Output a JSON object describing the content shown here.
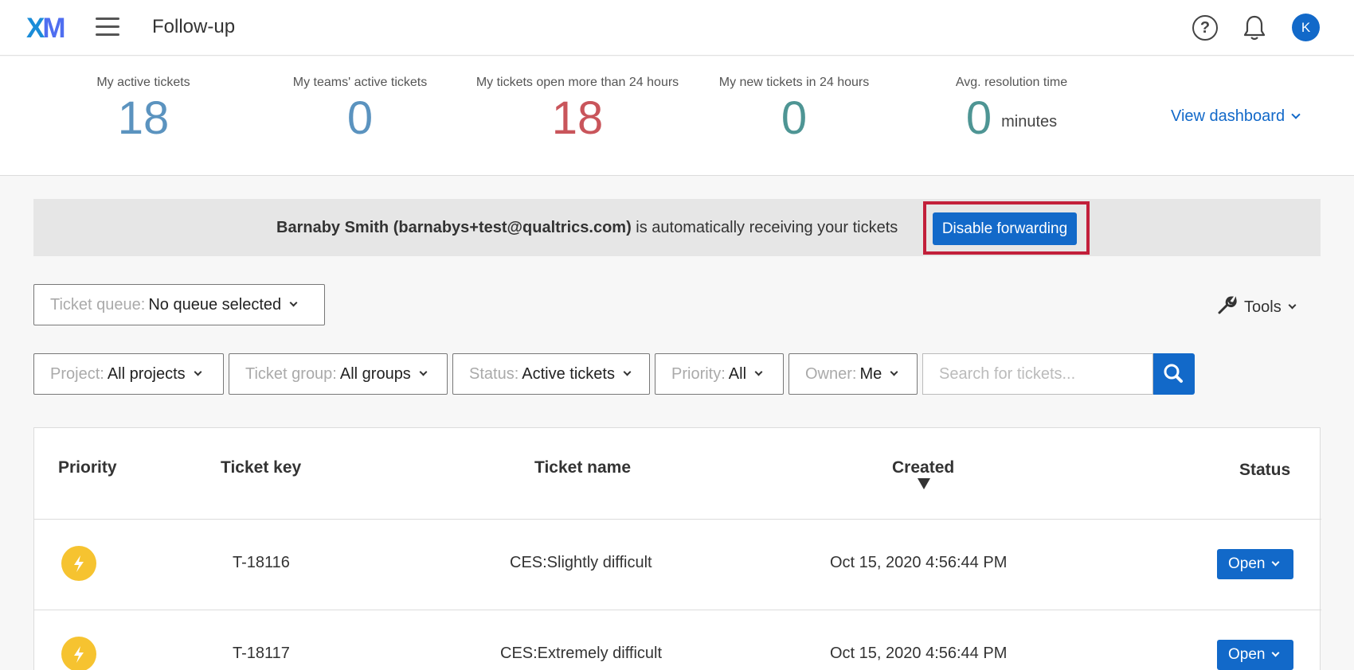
{
  "header": {
    "logo": {
      "x": "X",
      "m": "M"
    },
    "title": "Follow-up",
    "help_symbol": "?",
    "avatar_initial": "K",
    "icons": [
      "menu-icon",
      "help-icon",
      "bell-icon"
    ]
  },
  "stats": [
    {
      "label": "My active tickets",
      "value": "18",
      "color": "#5b93bf"
    },
    {
      "label": "My teams' active tickets",
      "value": "0",
      "color": "#5b93bf"
    },
    {
      "label": "My tickets open more than 24 hours",
      "value": "18",
      "color": "#c9555b"
    },
    {
      "label": "My new tickets in 24 hours",
      "value": "0",
      "color": "#4e9594"
    },
    {
      "label": "Avg. resolution time",
      "value": "0",
      "unit": "minutes",
      "color": "#4e9594"
    }
  ],
  "view_dashboard": "View dashboard",
  "banner": {
    "bold": "Barnaby Smith (barnabys+test@qualtrics.com)",
    "text": " is automatically receiving your tickets",
    "button": "Disable forwarding",
    "highlight_color": "#c21f3a"
  },
  "queue": {
    "label": "Ticket queue:",
    "value": "No queue selected"
  },
  "tools": "Tools",
  "filters": [
    {
      "label": "Project:",
      "value": "All projects"
    },
    {
      "label": "Ticket group:",
      "value": "All groups"
    },
    {
      "label": "Status:",
      "value": "Active tickets"
    },
    {
      "label": "Priority:",
      "value": "All"
    },
    {
      "label": "Owner:",
      "value": "Me"
    }
  ],
  "search": {
    "placeholder": "Search for tickets..."
  },
  "table": {
    "headers": {
      "priority": "Priority",
      "key": "Ticket key",
      "name": "Ticket name",
      "created": "Created",
      "status": "Status"
    },
    "rows": [
      {
        "key": "T-18116",
        "name": "CES:Slightly difficult",
        "created": "Oct 15, 2020 4:56:44 PM",
        "status": "Open"
      },
      {
        "key": "T-18117",
        "name": "CES:Extremely difficult",
        "created": "Oct 15, 2020 4:56:44 PM",
        "status": "Open"
      }
    ]
  },
  "colors": {
    "accent": "#1269c9",
    "priority": "#f6c330"
  }
}
